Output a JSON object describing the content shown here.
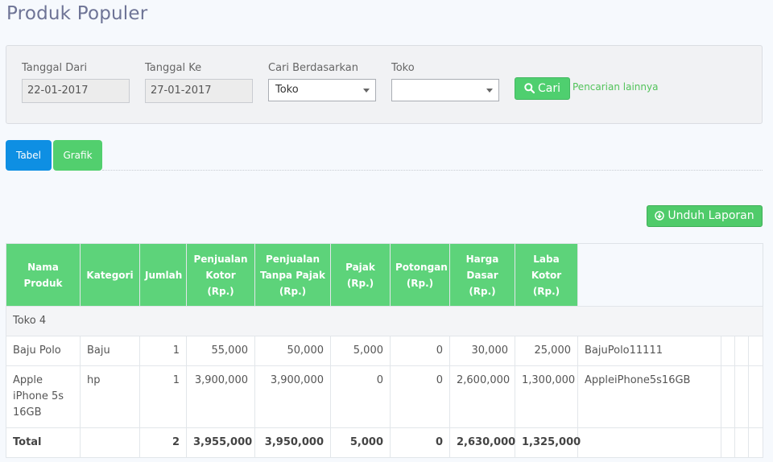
{
  "page_title": "Produk Populer",
  "filters": {
    "tanggal_dari_label": "Tanggal Dari",
    "tanggal_dari_value": "22-01-2017",
    "tanggal_ke_label": "Tanggal Ke",
    "tanggal_ke_value": "27-01-2017",
    "cari_berdasarkan_label": "Cari Berdasarkan",
    "cari_berdasarkan_value": "Toko",
    "toko_label": "Toko",
    "toko_value": "",
    "cari_button": "Cari",
    "lainnya_link": "Pencarian lainnya"
  },
  "tabs": {
    "tabel": "Tabel",
    "grafik": "Grafik"
  },
  "unduh_button": "Unduh Laporan",
  "table": {
    "headers": {
      "nama_produk": "Nama Produk",
      "kategori": "Kategori",
      "jumlah": "Jumlah",
      "penjualan_kotor": "Penjualan Kotor (Rp.)",
      "penjualan_tanpa_pajak": "Penjualan Tanpa Pajak (Rp.)",
      "pajak": "Pajak (Rp.)",
      "potongan": "Potongan (Rp.)",
      "harga_dasar": "Harga Dasar (Rp.)",
      "laba_kotor": "Laba Kotor (Rp.)"
    },
    "group": "Toko 4",
    "rows": [
      {
        "nama": "Baju Polo",
        "kategori": "Baju",
        "jumlah": "1",
        "penjualan_kotor": "55,000",
        "tanpa_pajak": "50,000",
        "pajak": "5,000",
        "potongan": "0",
        "harga_dasar": "30,000",
        "laba_kotor": "25,000",
        "sku": "BajuPolo11111"
      },
      {
        "nama": "Apple iPhone 5s 16GB",
        "kategori": "hp",
        "jumlah": "1",
        "penjualan_kotor": "3,900,000",
        "tanpa_pajak": "3,900,000",
        "pajak": "0",
        "potongan": "0",
        "harga_dasar": "2,600,000",
        "laba_kotor": "1,300,000",
        "sku": "AppleiPhone5s16GB"
      }
    ],
    "total": {
      "label": "Total",
      "jumlah": "2",
      "penjualan_kotor": "3,955,000",
      "tanpa_pajak": "3,950,000",
      "pajak": "5,000",
      "potongan": "0",
      "harga_dasar": "2,630,000",
      "laba_kotor": "1,325,000"
    }
  },
  "colors": {
    "green": "#5dd37a",
    "blue": "#0e8fe3",
    "title": "#6e7496"
  }
}
